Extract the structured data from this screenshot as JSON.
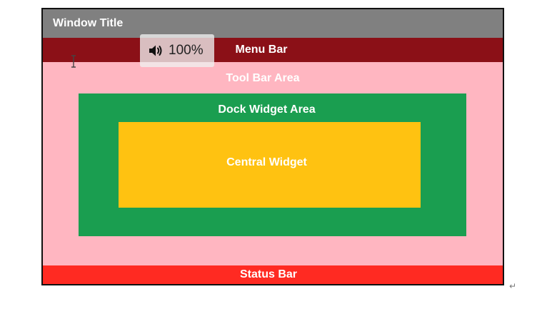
{
  "window": {
    "title": "Window Title",
    "menu_bar_label": "Menu Bar",
    "tool_bar_label": "Tool Bar Area",
    "dock_label": "Dock Widget Area",
    "central_label": "Central Widget",
    "status_bar_label": "Status Bar"
  },
  "volume_overlay": {
    "icon": "speaker-icon",
    "level_text": "100%"
  },
  "colors": {
    "title_bar": "#808080",
    "menu_bar": "#8b1017",
    "tool_bar_area": "#ffb6c1",
    "dock_widget_area": "#1a9e50",
    "central_widget": "#ffc211",
    "status_bar": "#ff2a22"
  },
  "icons": {
    "cursor": "text-cursor-icon",
    "paragraph_mark": "return-mark-icon"
  }
}
